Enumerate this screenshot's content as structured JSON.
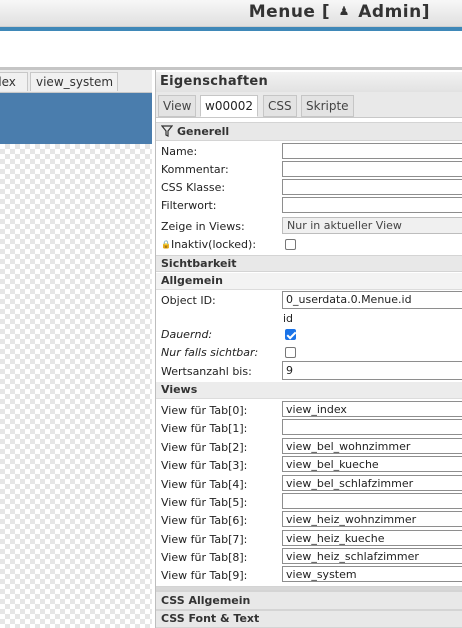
{
  "header": {
    "title_prefix": "Menue [",
    "user_icon": "user-icon",
    "title_user": "Admin]"
  },
  "left_tabs": [
    "dex",
    "view_system"
  ],
  "panel": {
    "title": "Eigenschaften",
    "tabs": [
      "View",
      "w00002",
      "CSS",
      "Skripte"
    ],
    "active_tab": "w00002"
  },
  "generell": {
    "section_label": "Generell",
    "fields": [
      {
        "label": "Name:",
        "value": ""
      },
      {
        "label": "Kommentar:",
        "value": ""
      },
      {
        "label": "CSS Klasse:",
        "value": ""
      },
      {
        "label": "Filterwort:",
        "value": ""
      }
    ],
    "views_label": "Zeige in Views:",
    "views_value": "Nur in aktueller View",
    "locked_label": "Inaktiv(locked):",
    "locked_checked": false
  },
  "sichtbarkeit": {
    "section_label": "Sichtbarkeit"
  },
  "allgemein": {
    "section_label": "Allgemein",
    "oid_label": "Object ID:",
    "oid_value": "0_userdata.0.Menue.id",
    "oid_hint": "id",
    "dauernd_label": "Dauernd:",
    "dauernd_checked": true,
    "nur_label": "Nur falls sichtbar:",
    "nur_checked": false,
    "werts_label": "Wertsanzahl bis:",
    "werts_value": "9"
  },
  "views": {
    "section_label": "Views",
    "rows": [
      {
        "label": "View für Tab[0]:",
        "value": "view_index"
      },
      {
        "label": "View für Tab[1]:",
        "value": ""
      },
      {
        "label": "View für Tab[2]:",
        "value": "view_bel_wohnzimmer"
      },
      {
        "label": "View für Tab[3]:",
        "value": "view_bel_kueche"
      },
      {
        "label": "View für Tab[4]:",
        "value": "view_bel_schlafzimmer"
      },
      {
        "label": "View für Tab[5]:",
        "value": ""
      },
      {
        "label": "View für Tab[6]:",
        "value": "view_heiz_wohnzimmer"
      },
      {
        "label": "View für Tab[7]:",
        "value": "view_heiz_kueche"
      },
      {
        "label": "View für Tab[8]:",
        "value": "view_heiz_schlafzimmer"
      },
      {
        "label": "View für Tab[9]:",
        "value": "view_system"
      }
    ]
  },
  "css_allgemein": {
    "section_label": "CSS Allgemein"
  },
  "css_font": {
    "section_label": "CSS Font & Text"
  }
}
